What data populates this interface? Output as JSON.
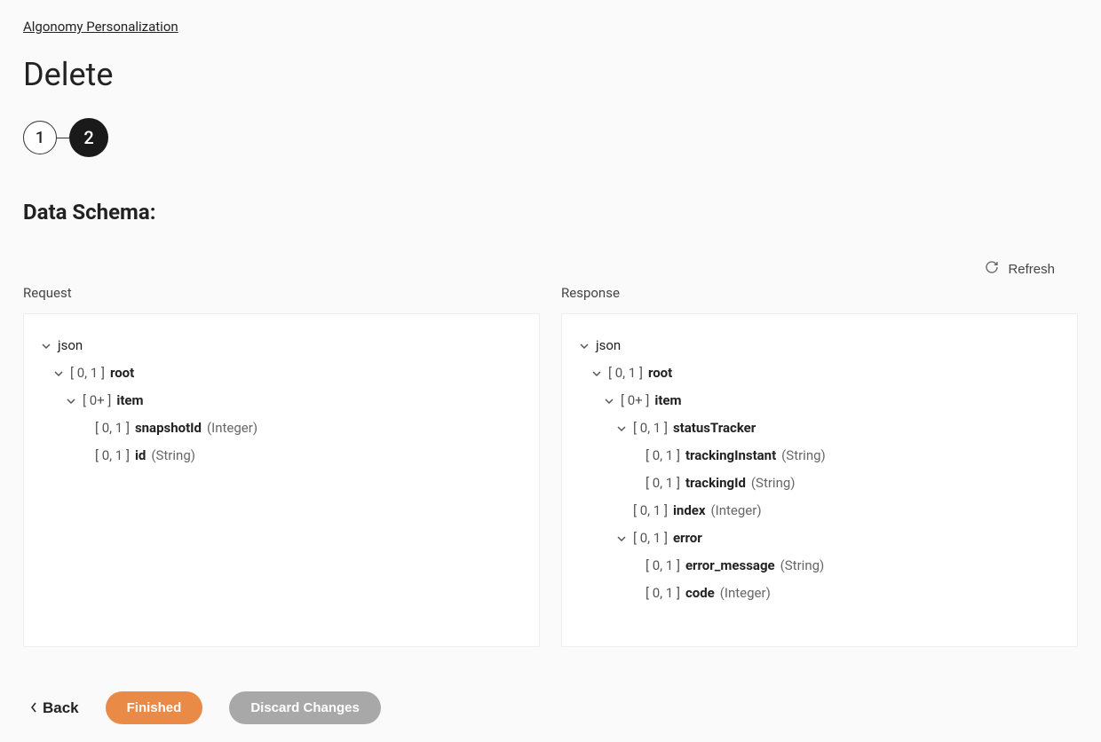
{
  "breadcrumb": "Algonomy Personalization",
  "page_title": "Delete",
  "stepper": {
    "step1": "1",
    "step2": "2"
  },
  "section_title": "Data Schema:",
  "refresh_label": "Refresh",
  "request_label": "Request",
  "response_label": "Response",
  "request_tree": {
    "root_label": "json",
    "root": {
      "card": "[ 0, 1 ]",
      "name": "root",
      "item": {
        "card": "[ 0+ ]",
        "name": "item",
        "fields": [
          {
            "card": "[ 0, 1 ]",
            "name": "snapshotId",
            "type": "(Integer)"
          },
          {
            "card": "[ 0, 1 ]",
            "name": "id",
            "type": "(String)"
          }
        ]
      }
    }
  },
  "response_tree": {
    "root_label": "json",
    "root": {
      "card": "[ 0, 1 ]",
      "name": "root",
      "item": {
        "card": "[ 0+ ]",
        "name": "item",
        "statusTracker": {
          "card": "[ 0, 1 ]",
          "name": "statusTracker",
          "fields": [
            {
              "card": "[ 0, 1 ]",
              "name": "trackingInstant",
              "type": "(String)"
            },
            {
              "card": "[ 0, 1 ]",
              "name": "trackingId",
              "type": "(String)"
            }
          ]
        },
        "index": {
          "card": "[ 0, 1 ]",
          "name": "index",
          "type": "(Integer)"
        },
        "error": {
          "card": "[ 0, 1 ]",
          "name": "error",
          "fields": [
            {
              "card": "[ 0, 1 ]",
              "name": "error_message",
              "type": "(String)"
            },
            {
              "card": "[ 0, 1 ]",
              "name": "code",
              "type": "(Integer)"
            }
          ]
        }
      }
    }
  },
  "footer": {
    "back": "Back",
    "finished": "Finished",
    "discard": "Discard Changes"
  }
}
